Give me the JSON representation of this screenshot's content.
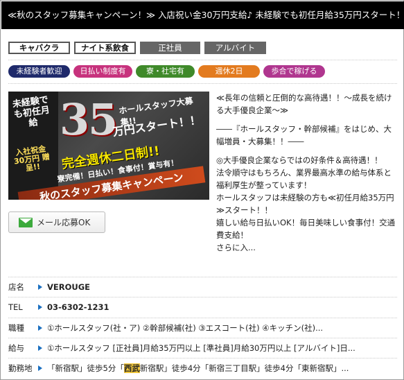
{
  "header": {
    "title": "≪秋のスタッフ募集キャンペーン！≫ 入店祝い金30万円支給♪ 未経験でも初任月給35万円スタート！！"
  },
  "categories": [
    {
      "label": "キャバクラ",
      "style": "outline"
    },
    {
      "label": "ナイト系飲食",
      "style": "outline"
    },
    {
      "label": "正社員",
      "style": "filled"
    },
    {
      "label": "アルバイト",
      "style": "filled"
    }
  ],
  "badges": [
    {
      "label": "未経験者歓迎",
      "color": "#1f2a6b"
    },
    {
      "label": "日払い制度有",
      "color": "#c7327d"
    },
    {
      "label": "寮・社宅有",
      "color": "#3f8a2a"
    },
    {
      "label": "週休2日",
      "color": "#e37b1f"
    },
    {
      "label": "歩合で稼げる",
      "color": "#b0368f"
    }
  ],
  "banner": {
    "l1": "未経験でも初任月給",
    "big": "35",
    "l2": "ホールスタッフ大募集!!",
    "l3": "万円スタート！！",
    "l4": "完全週休二日制!!",
    "l5": "入社祝金 30万円 贈呈!!",
    "l6": "寮完備！日払い！食事付！賞与有！",
    "l7": "秋のスタッフ募集キャンペーン"
  },
  "mail_button": {
    "label": "メール応募OK"
  },
  "description": {
    "p1": "≪長年の信頼と圧倒的な高待遇！！～成長を続ける大手優良企業～≫",
    "p2": "――『ホールスタッフ・幹部候補』をはじめ、大幅増員・大募集！！――",
    "p3": "◎大手優良企業ならではの好条件＆高待遇！！\n法令順守はもちろん、業界最高水準の給与体系と福利厚生が整っています！\nホールスタッフは未経験の方も≪初任月給35万円≫スタート！！\n嬉しい給与日払いOK！毎日美味しい食事付！交通費支給！\nさらに入..."
  },
  "info": {
    "shop": {
      "label": "店名",
      "value": "VEROUGE"
    },
    "tel": {
      "label": "TEL",
      "value": "03-6302-1231"
    },
    "job": {
      "label": "職種",
      "value": "①ホールスタッフ(社・ア) ②幹部候補(社) ③エスコート(社) ④キッチン(社)..."
    },
    "pay": {
      "label": "給与",
      "value": "①ホールスタッフ [正社員]月給35万円以上 [準社員]月給30万円以上 [アルバイト]日..."
    },
    "location": {
      "label": "勤務地",
      "pre": "「新宿駅」徒歩5分「",
      "highlight": "西武",
      "post": "新宿駅」徒歩4分「新宿三丁目駅」徒歩4分「東新宿駅」..."
    }
  }
}
